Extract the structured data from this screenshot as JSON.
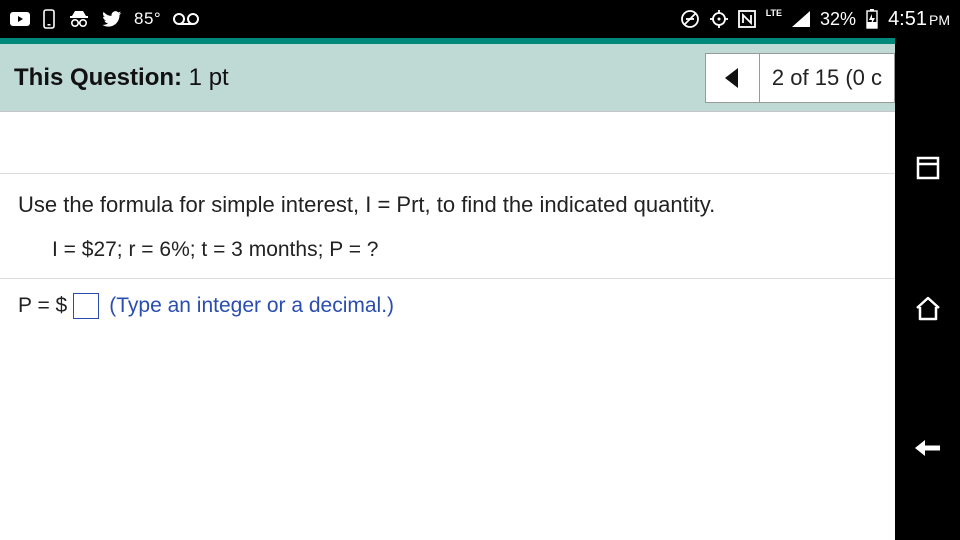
{
  "status": {
    "temperature": "85°",
    "lte": "LTE",
    "battery_pct": "32%",
    "time": "4:51",
    "ampm": "PM"
  },
  "header": {
    "label_prefix": "This Question:",
    "points": "1 pt",
    "progress": "2 of 15 (0 c"
  },
  "problem": {
    "instruction": "Use the formula for simple interest, I = Prt, to find the indicated quantity.",
    "given": "I = $27; r = 6%; t = 3 months; P = ?"
  },
  "answer": {
    "prefix": "P = $",
    "hint": "(Type an integer or a decimal.)"
  }
}
